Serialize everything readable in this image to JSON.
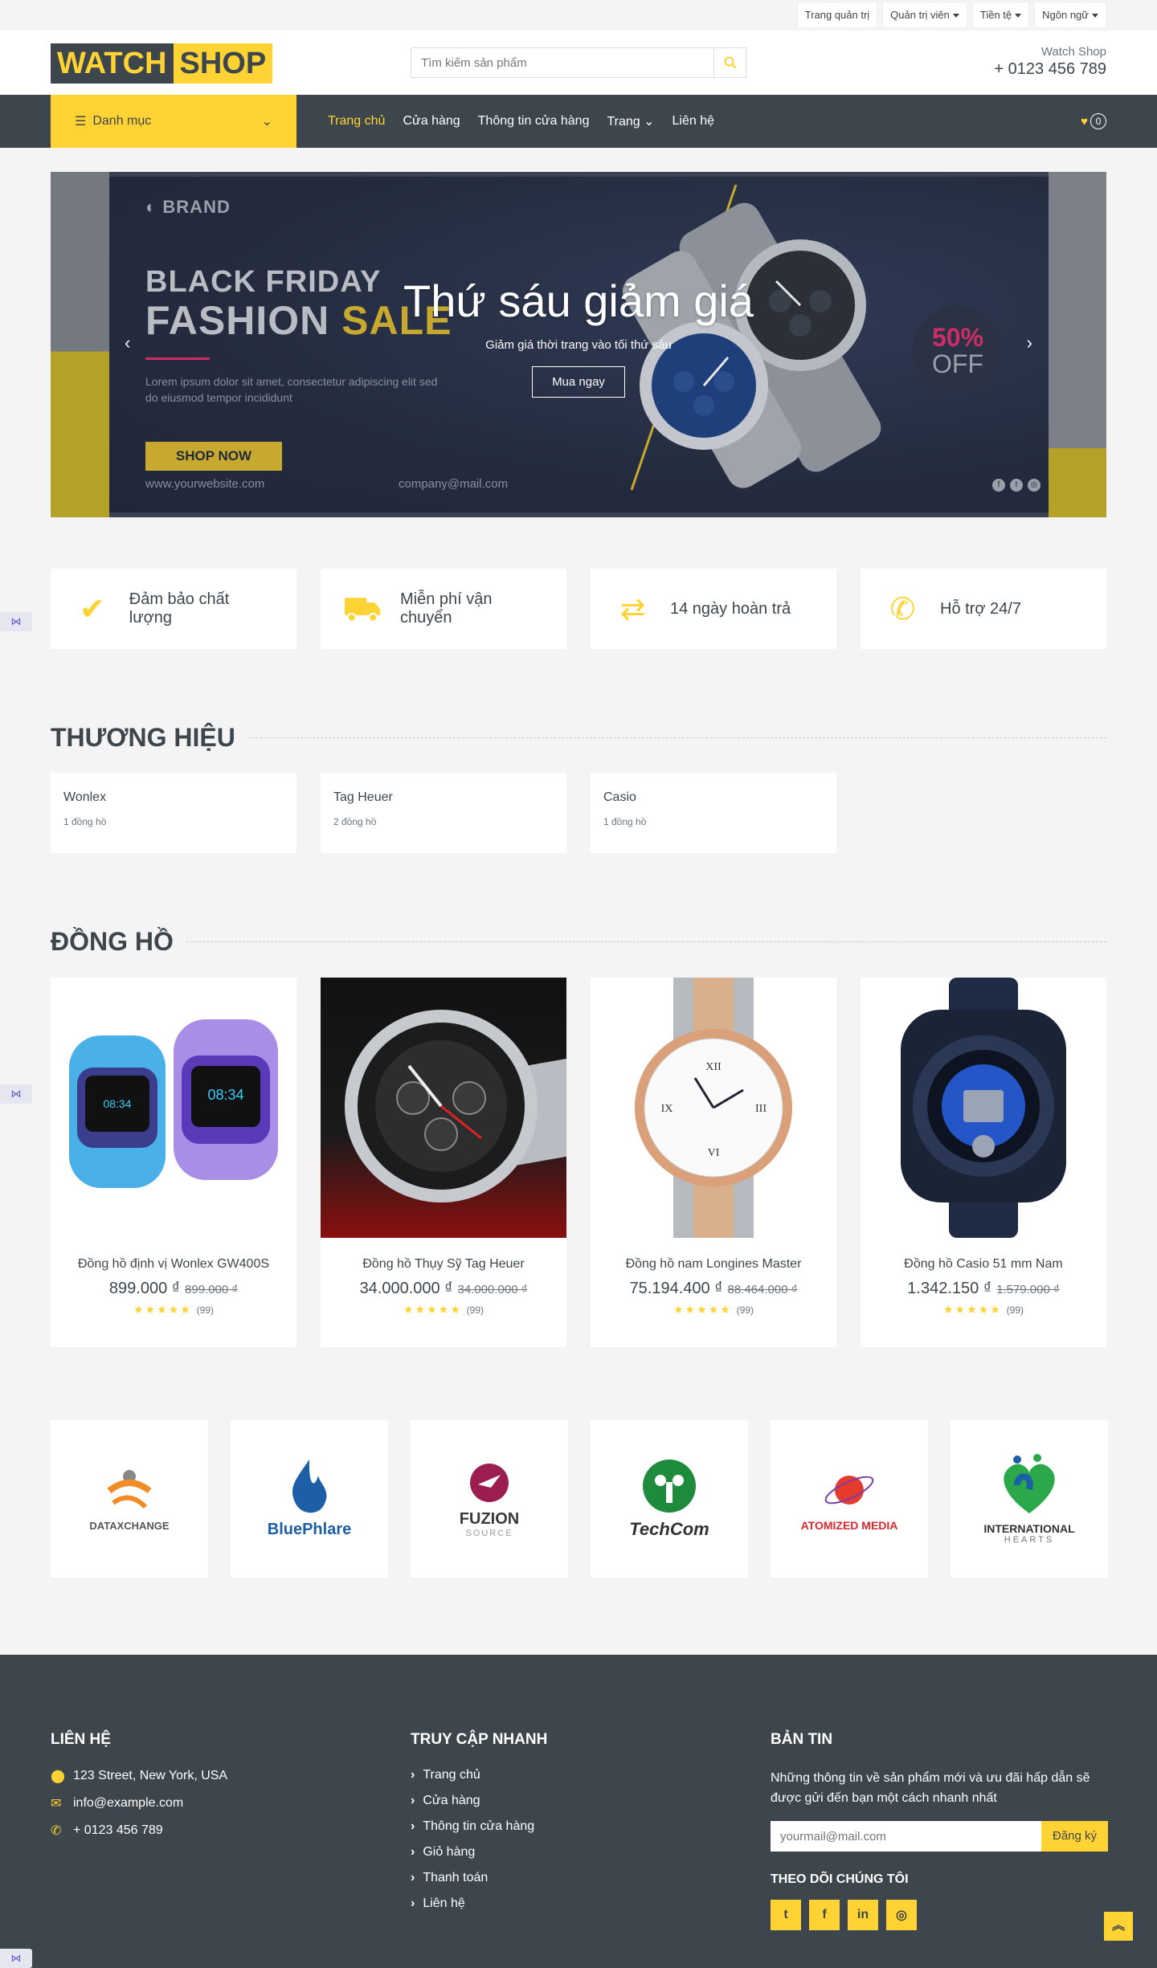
{
  "topbar": {
    "admin": "Trang quản trị",
    "members": "Quản trị viên",
    "currency": "Tiền tệ",
    "language": "Ngôn ngữ"
  },
  "header": {
    "logo_part1": "WATCH",
    "logo_part2": "SHOP",
    "search_placeholder": "Tìm kiếm sản phẩm",
    "shop_name": "Watch Shop",
    "phone": "+ 0123 456 789"
  },
  "nav": {
    "categories": "Danh mục",
    "links": [
      "Trang chủ",
      "Cửa hàng",
      "Thông tin cửa hàng",
      "Trang",
      "Liên hệ"
    ],
    "wishlist_count": "0"
  },
  "banner": {
    "brand": "BRAND",
    "line1": "BLACK FRIDAY",
    "line2a": "FASHION ",
    "line2b": "SALE",
    "lorem": "Lorem ipsum dolor sit amet, consectetur adipiscing elit sed do eiusmod tempor incididunt",
    "shop_now": "SHOP NOW",
    "website": "www.yourwebsite.com",
    "email": "company@mail.com",
    "off_pct": "50%",
    "off_word": "OFF",
    "title": "Thứ sáu giảm giá",
    "subtitle": "Giảm giá thời trang vào tối thứ sáu",
    "cta": "Mua ngay"
  },
  "features": [
    "Đảm bảo chất lượng",
    "Miễn phí vận chuyển",
    "14 ngày hoàn trả",
    "Hỗ trợ 24/7"
  ],
  "brands_section": {
    "title": "THƯƠNG HIỆU",
    "items": [
      {
        "name": "Wonlex",
        "count": "1 đồng hồ"
      },
      {
        "name": "Tag Heuer",
        "count": "2 đồng hồ"
      },
      {
        "name": "Casio",
        "count": "1 đồng hồ"
      }
    ]
  },
  "products_section": {
    "title": "ĐỒNG HỒ",
    "items": [
      {
        "name": "Đồng hồ định vị Wonlex GW400S",
        "price": "899.000 ₫",
        "old_price": "899.000 ₫",
        "reviews": "(99)"
      },
      {
        "name": "Đồng hồ Thụy Sỹ Tag Heuer",
        "price": "34.000.000 ₫",
        "old_price": "34.000.000 ₫",
        "reviews": "(99)"
      },
      {
        "name": "Đồng hồ nam Longines Master",
        "price": "75.194.400 ₫",
        "old_price": "88.464.000 ₫",
        "reviews": "(99)"
      },
      {
        "name": "Đồng hồ Casio 51 mm Nam",
        "price": "1.342.150 ₫",
        "old_price": "1.579.000 ₫",
        "reviews": "(99)"
      }
    ]
  },
  "vendors": [
    {
      "name": "DATAXCHANGE",
      "color": "#f28c28"
    },
    {
      "name": "BluePhlare",
      "color": "#1d5fa6"
    },
    {
      "name": "FUZION",
      "sub": "SOURCE",
      "color": "#3a3a3a"
    },
    {
      "name": "TechCom",
      "color": "#1e8a3c"
    },
    {
      "name": "ATOMIZED MEDIA",
      "color": "#d9282f"
    },
    {
      "name": "INTERNATIONAL",
      "sub": "HEARTS",
      "color": "#333"
    }
  ],
  "footer": {
    "contact_title": "LIÊN HỆ",
    "address": "123 Street, New York, USA",
    "email": "info@example.com",
    "phone": "+ 0123 456 789",
    "quick_title": "TRUY CẬP NHANH",
    "quick_links": [
      "Trang chủ",
      "Cửa hàng",
      "Thông tin cửa hàng",
      "Giỏ hàng",
      "Thanh toán",
      "Liên hệ"
    ],
    "news_title": "BẢN TIN",
    "news_text": "Những thông tin về sản phẩm mới và ưu đãi hấp dẫn sẽ được gửi đến bạn một cách nhanh nhất",
    "news_placeholder": "yourmail@mail.com",
    "subscribe": "Đăng ký",
    "follow": "THEO DÕI CHÚNG TÔI"
  },
  "colors": {
    "accent": "#ffd333",
    "dark": "#3d464d"
  }
}
